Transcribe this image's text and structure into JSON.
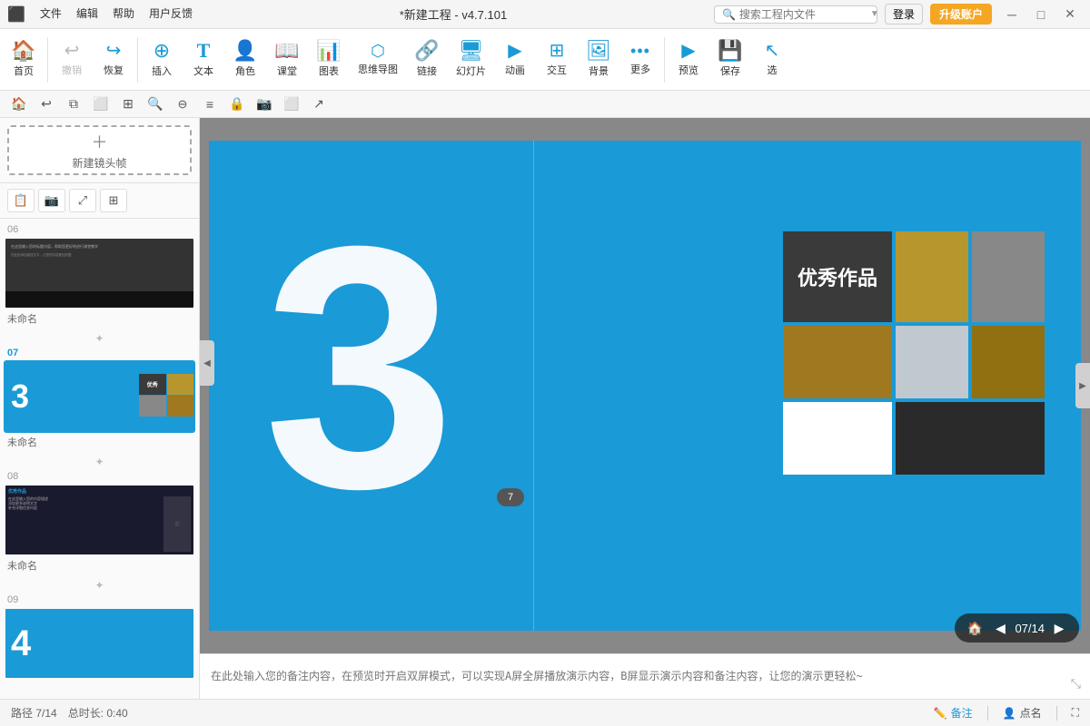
{
  "app": {
    "title": "*新建工程 - v4.7.101"
  },
  "titlebar": {
    "menu": [
      "文件",
      "编辑",
      "帮助",
      "用户反馈"
    ],
    "search_placeholder": "搜索工程内文件",
    "login_label": "登录",
    "upgrade_label": "升级账户",
    "win_minimize": "─",
    "win_restore": "□",
    "win_close": "✕"
  },
  "toolbar": {
    "items": [
      {
        "id": "home",
        "icon": "🏠",
        "label": "首页"
      },
      {
        "id": "undo",
        "icon": "↩",
        "label": "撤销"
      },
      {
        "id": "redo",
        "icon": "↪",
        "label": "恢复"
      },
      {
        "id": "insert",
        "icon": "⊕",
        "label": "插入"
      },
      {
        "id": "text",
        "icon": "T",
        "label": "文本"
      },
      {
        "id": "role",
        "icon": "👤",
        "label": "角色"
      },
      {
        "id": "lesson",
        "icon": "📖",
        "label": "课堂"
      },
      {
        "id": "chart",
        "icon": "📊",
        "label": "图表"
      },
      {
        "id": "mindmap",
        "icon": "🔀",
        "label": "思维导图"
      },
      {
        "id": "link",
        "icon": "🔗",
        "label": "链接"
      },
      {
        "id": "slideshow",
        "icon": "🖥",
        "label": "幻灯片"
      },
      {
        "id": "animation",
        "icon": "▷",
        "label": "动画"
      },
      {
        "id": "interact",
        "icon": "☰",
        "label": "交互"
      },
      {
        "id": "background",
        "icon": "🖼",
        "label": "背景"
      },
      {
        "id": "more",
        "icon": "···",
        "label": "更多"
      },
      {
        "id": "preview",
        "icon": "▶",
        "label": "预览"
      },
      {
        "id": "save",
        "icon": "💾",
        "label": "保存"
      },
      {
        "id": "select",
        "icon": "↗",
        "label": "选"
      }
    ]
  },
  "secondary_toolbar": {
    "buttons": [
      "🏠",
      "↩",
      "⧉",
      "⬜",
      "⊞",
      "🔍+",
      "🔍-",
      "≡",
      "🔒",
      "📷",
      "⬜",
      "↗"
    ]
  },
  "sidebar": {
    "new_frame_label": "新建镜头帧",
    "tools": [
      "📋",
      "📷",
      "⤢",
      "⊞"
    ],
    "slides": [
      {
        "number": "06",
        "name": "未命名",
        "type": "text_dark"
      },
      {
        "number": "07",
        "name": "未命名",
        "type": "number_3",
        "active": true
      },
      {
        "number": "08",
        "name": "未命名",
        "type": "showcase"
      },
      {
        "number": "09",
        "name": "",
        "type": "number_4"
      }
    ]
  },
  "canvas": {
    "big_number": "3",
    "grid_label": "优秀作品",
    "guide_bubble": "7"
  },
  "notes": {
    "placeholder": "在此处输入您的备注内容，在预览时开启双屏模式，可以实现A屏全屏播放演示内容，B屏显示演示内容和备注内容，让您的演示更轻松~"
  },
  "statusbar": {
    "slide_info": "路径 7/14",
    "duration": "总时长: 0:40",
    "note_label": "备注",
    "point_label": "点名",
    "nav_current": "07/14"
  },
  "colors": {
    "accent": "#1a9ad7",
    "upgrade_bg": "#f5a623",
    "canvas_bg": "#1a9ad7"
  }
}
